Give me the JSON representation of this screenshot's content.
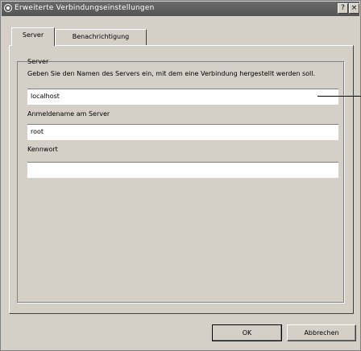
{
  "window": {
    "title": "Erweiterte Verbindungseinstellungen",
    "help_button": "?",
    "close_button": "×"
  },
  "tabs": [
    {
      "label": "Server"
    },
    {
      "label": "Benachrichtigung"
    }
  ],
  "group": {
    "title": "Server",
    "description": "Geben Sie den Namen des Servers ein, mit dem eine Verbindung hergestellt werden soll.",
    "server_value": "localhost"
  },
  "fields": [
    {
      "label": "Anmeldename am Server",
      "value": "root"
    },
    {
      "label": "Kennwort",
      "value": ""
    }
  ],
  "buttons": {
    "ok": "OK",
    "cancel": "Abbrechen"
  }
}
